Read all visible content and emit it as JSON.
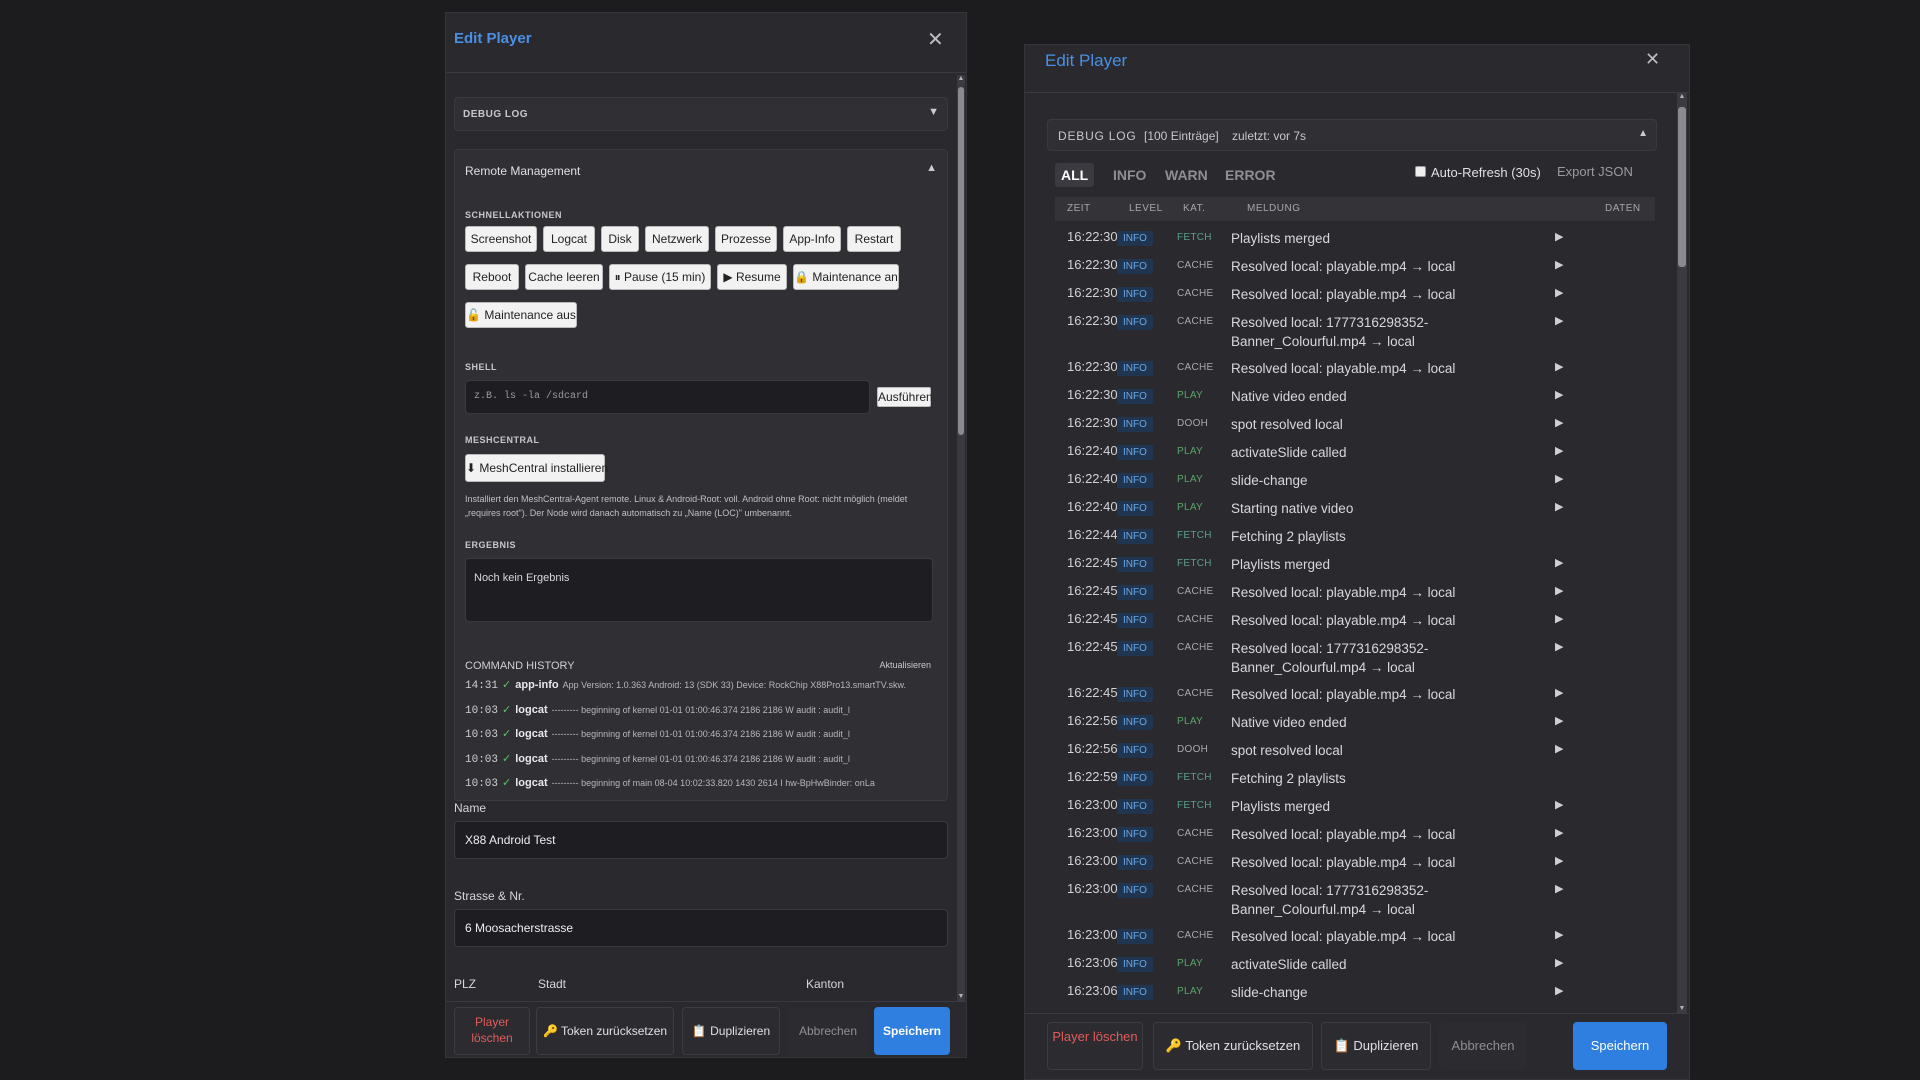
{
  "left": {
    "title": "Edit Player",
    "debug_log_label": "DEBUG LOG",
    "remote_management": "Remote Management",
    "quick_actions_label": "SCHNELLAKTIONEN",
    "quick_actions": [
      "Screenshot",
      "Logcat",
      "Disk",
      "Netzwerk",
      "Prozesse",
      "App-Info",
      "Restart",
      "Reboot",
      "Cache leeren",
      "⏸ Pause (15 min)",
      "▶ Resume",
      "🔒 Maintenance an",
      "🔓 Maintenance aus"
    ],
    "shell_label": "SHELL",
    "shell_placeholder": "z.B. ls -la /sdcard",
    "shell_run": "Ausführen",
    "meshcentral_label": "MESHCENTRAL",
    "meshcentral_button": "⬇ MeshCentral installieren",
    "meshcentral_info": "Installiert den MeshCentral-Agent remote. Linux & Android-Root: voll. Android ohne Root: nicht möglich (meldet „requires root\"). Der Node wird danach automatisch zu „Name (LOC)\" umbenannt.",
    "result_label": "ERGEBNIS",
    "result_text": "Noch kein Ergebnis",
    "history_label": "COMMAND HISTORY",
    "history_refresh": "Aktualisieren",
    "history": [
      {
        "time": "14:31",
        "cmd": "app-info",
        "out": "App Version: 1.0.363 Android: 13 (SDK 33) Device: RockChip X88Pro13.smartTV.skw."
      },
      {
        "time": "10:03",
        "cmd": "logcat",
        "out": "--------- beginning of kernel 01-01 01:00:46.374 2186 2186 W audit : audit_l"
      },
      {
        "time": "10:03",
        "cmd": "logcat",
        "out": "--------- beginning of kernel 01-01 01:00:46.374 2186 2186 W audit : audit_l"
      },
      {
        "time": "10:03",
        "cmd": "logcat",
        "out": "--------- beginning of kernel 01-01 01:00:46.374 2186 2186 W audit : audit_l"
      },
      {
        "time": "10:03",
        "cmd": "logcat",
        "out": "--------- beginning of main 08-04 10:02:33.820 1430 2614 I hw-BpHwBinder: onLa"
      }
    ],
    "name_label": "Name",
    "name_value": "X88 Android Test",
    "street_label": "Strasse & Nr.",
    "street_value": "6 Moosacherstrasse",
    "plz_label": "PLZ",
    "city_label": "Stadt",
    "canton_label": "Kanton"
  },
  "footer": {
    "delete": "Player löschen",
    "token": "🔑 Token zurücksetzen",
    "duplicate": "📋 Duplizieren",
    "cancel": "Abbrechen",
    "save": "Speichern"
  },
  "right": {
    "title": "Edit Player",
    "debug_log_label": "DEBUG LOG",
    "entry_count": "[100 Einträge]",
    "last_update": "zuletzt: vor 7s",
    "filters": [
      "ALL",
      "INFO",
      "WARN",
      "ERROR"
    ],
    "auto_refresh": "Auto-Refresh (30s)",
    "export": "Export JSON",
    "columns": {
      "time": "ZEIT",
      "level": "LEVEL",
      "cat": "KAT.",
      "msg": "MELDUNG",
      "data": "DATEN"
    },
    "rows": [
      {
        "time": "16:22:30",
        "level": "INFO",
        "cat": "FETCH",
        "msg": "Playlists merged",
        "arrow": true
      },
      {
        "time": "16:22:30",
        "level": "INFO",
        "cat": "CACHE",
        "msg": "Resolved local: playable.mp4 → local",
        "arrow": true
      },
      {
        "time": "16:22:30",
        "level": "INFO",
        "cat": "CACHE",
        "msg": "Resolved local: playable.mp4 → local",
        "arrow": true
      },
      {
        "time": "16:22:30",
        "level": "INFO",
        "cat": "CACHE",
        "msg": "Resolved local: 1777316298352-Banner_Colourful.mp4 → local",
        "arrow": true
      },
      {
        "time": "16:22:30",
        "level": "INFO",
        "cat": "CACHE",
        "msg": "Resolved local: playable.mp4 → local",
        "arrow": true
      },
      {
        "time": "16:22:30",
        "level": "INFO",
        "cat": "PLAY",
        "msg": "Native video ended",
        "arrow": true
      },
      {
        "time": "16:22:30",
        "level": "INFO",
        "cat": "DOOH",
        "msg": "spot resolved local",
        "arrow": true
      },
      {
        "time": "16:22:40",
        "level": "INFO",
        "cat": "PLAY",
        "msg": "activateSlide called",
        "arrow": true
      },
      {
        "time": "16:22:40",
        "level": "INFO",
        "cat": "PLAY",
        "msg": "slide-change",
        "arrow": true
      },
      {
        "time": "16:22:40",
        "level": "INFO",
        "cat": "PLAY",
        "msg": "Starting native video",
        "arrow": true
      },
      {
        "time": "16:22:44",
        "level": "INFO",
        "cat": "FETCH",
        "msg": "Fetching 2 playlists",
        "arrow": false
      },
      {
        "time": "16:22:45",
        "level": "INFO",
        "cat": "FETCH",
        "msg": "Playlists merged",
        "arrow": true
      },
      {
        "time": "16:22:45",
        "level": "INFO",
        "cat": "CACHE",
        "msg": "Resolved local: playable.mp4 → local",
        "arrow": true
      },
      {
        "time": "16:22:45",
        "level": "INFO",
        "cat": "CACHE",
        "msg": "Resolved local: playable.mp4 → local",
        "arrow": true
      },
      {
        "time": "16:22:45",
        "level": "INFO",
        "cat": "CACHE",
        "msg": "Resolved local: 1777316298352-Banner_Colourful.mp4 → local",
        "arrow": true
      },
      {
        "time": "16:22:45",
        "level": "INFO",
        "cat": "CACHE",
        "msg": "Resolved local: playable.mp4 → local",
        "arrow": true
      },
      {
        "time": "16:22:56",
        "level": "INFO",
        "cat": "PLAY",
        "msg": "Native video ended",
        "arrow": true
      },
      {
        "time": "16:22:56",
        "level": "INFO",
        "cat": "DOOH",
        "msg": "spot resolved local",
        "arrow": true
      },
      {
        "time": "16:22:59",
        "level": "INFO",
        "cat": "FETCH",
        "msg": "Fetching 2 playlists",
        "arrow": false
      },
      {
        "time": "16:23:00",
        "level": "INFO",
        "cat": "FETCH",
        "msg": "Playlists merged",
        "arrow": true
      },
      {
        "time": "16:23:00",
        "level": "INFO",
        "cat": "CACHE",
        "msg": "Resolved local: playable.mp4 → local",
        "arrow": true
      },
      {
        "time": "16:23:00",
        "level": "INFO",
        "cat": "CACHE",
        "msg": "Resolved local: playable.mp4 → local",
        "arrow": true
      },
      {
        "time": "16:23:00",
        "level": "INFO",
        "cat": "CACHE",
        "msg": "Resolved local: 1777316298352-Banner_Colourful.mp4 → local",
        "arrow": true
      },
      {
        "time": "16:23:00",
        "level": "INFO",
        "cat": "CACHE",
        "msg": "Resolved local: playable.mp4 → local",
        "arrow": true
      },
      {
        "time": "16:23:06",
        "level": "INFO",
        "cat": "PLAY",
        "msg": "activateSlide called",
        "arrow": true
      },
      {
        "time": "16:23:06",
        "level": "INFO",
        "cat": "PLAY",
        "msg": "slide-change",
        "arrow": true
      }
    ]
  },
  "colors": {
    "accent": "#4a8fe4",
    "danger": "#e25b5b",
    "fetch": "#5a9e8a",
    "cache": "#a8a8ae",
    "play": "#5aa66a",
    "dooh": "#a8a8ae"
  }
}
